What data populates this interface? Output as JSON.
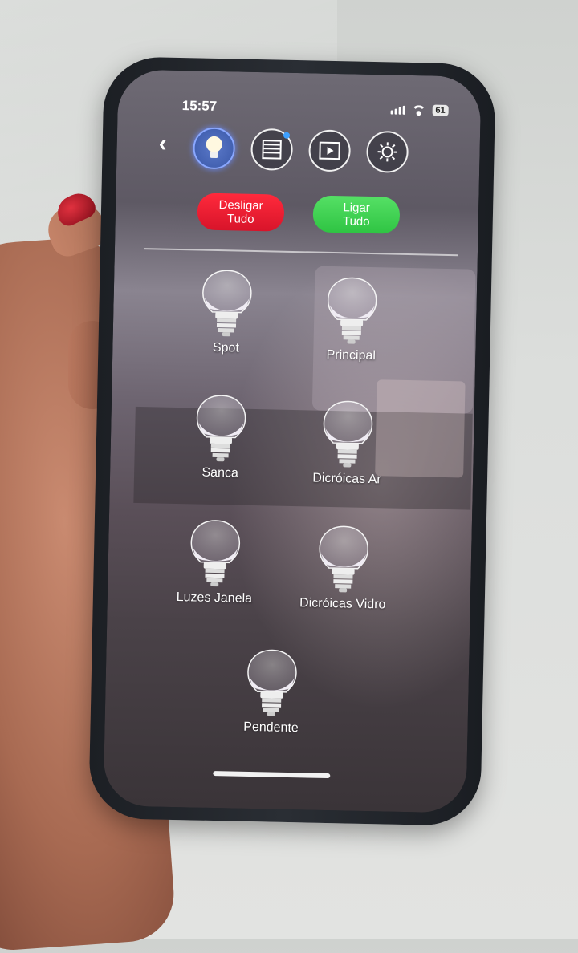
{
  "status": {
    "time": "15:57",
    "battery": "61"
  },
  "toolbar": {
    "icons": [
      "lightbulb-icon",
      "blinds-icon",
      "media-icon",
      "scene-icon"
    ]
  },
  "actions": {
    "off_label": "Desligar\nTudo",
    "on_label": "Ligar\nTudo"
  },
  "lights": [
    {
      "label": "Spot"
    },
    {
      "label": "Principal"
    },
    {
      "label": "Sanca"
    },
    {
      "label": "Dicróicas Ar"
    },
    {
      "label": "Luzes Janela"
    },
    {
      "label": "Dicróicas Vidro"
    },
    {
      "label": "Pendente"
    }
  ],
  "colors": {
    "off_button": "#e0182e",
    "on_button": "#3fd253",
    "active_icon": "#4a68c0"
  }
}
